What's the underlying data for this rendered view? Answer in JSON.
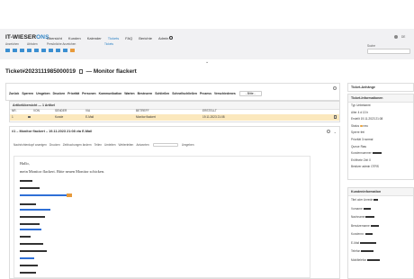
{
  "header": {
    "logo_part1": "IT-WIESER",
    "logo_part2": "ONS",
    "nav": [
      "Übersicht",
      "Kunden",
      "Kalender",
      "Tickets",
      "FAQ",
      "Berichte",
      "Admin"
    ],
    "active_nav": "Tickets",
    "user_initials": "DE",
    "sub_labels": [
      "Anzeichen",
      "Abholen",
      "Persönliche Anzeichen"
    ],
    "search_label": "Suche",
    "search_placeholder": "",
    "tickets_sub": "Tickets"
  },
  "ticket": {
    "title": "Ticket#2023111985000019",
    "subject_sep": "—",
    "subject": "Monitor flackert",
    "menu": [
      "Zurück",
      "Sperren",
      "Umgeben",
      "Drucken",
      "Priorität",
      "Personen",
      "Kommunikation",
      "Warten",
      "Besteuern",
      "Schließen",
      "Schnellschließen",
      "Prozess",
      "Verschiedenes"
    ],
    "menu_select": "- Bitte -"
  },
  "articles": {
    "title": "Artikelübersicht — 1 Artikel",
    "columns": [
      "NR.",
      "",
      "VON",
      "SENDER",
      "VIA",
      "BETREFF",
      "ERSTELLT"
    ],
    "rows": [
      {
        "nr": "1",
        "flag": "",
        "von": "",
        "sender": "Kunde",
        "via": "E-Mail",
        "betreff": "Monitor flackert",
        "erstellt": "19.11.2023 21:08"
      }
    ]
  },
  "article": {
    "title": "#1 – Monitor flackert – 19.11.2023 21:08 via E-Mail",
    "toolbar": [
      "Nachrichtenkopf anzeigen",
      "Drucken",
      "Zeitbuchungen ändern",
      "Teilen",
      "Umleiten",
      "Weiterleiten",
      "Antworten"
    ],
    "toolbar_select": "",
    "toolbar_last": "Umgeben",
    "greeting": "Hallo,",
    "body_line": "mein Monitor flackert. Bitte neuen Monitor schicken."
  },
  "sidebar": {
    "settings_title": "Ticket-Anhänge",
    "info_title": "Ticket-Informationen",
    "info": [
      {
        "label": "Typ",
        "value": "Unbekannt"
      },
      {
        "label": "Alter",
        "value": "4 d 13 h"
      },
      {
        "label": "Erstellt",
        "value": "19.11.2023 21:08"
      },
      {
        "label": "Status",
        "value": "neu"
      },
      {
        "label": "Sperre",
        "value": "frei"
      },
      {
        "label": "Priorität",
        "value": "3 normal"
      },
      {
        "label": "Queue",
        "value": "Raw"
      },
      {
        "label": "Kundennummer",
        "value": ""
      },
      {
        "label": "Eröffnete Zeit",
        "value": "0"
      },
      {
        "label": "Besitzer",
        "value": "admin OTRS"
      }
    ],
    "customer_title": "Kundeninformation",
    "customer": [
      {
        "label": "Titel oder Anrede",
        "value": ""
      },
      {
        "label": "Vorname",
        "value": ""
      },
      {
        "label": "Nachname",
        "value": ""
      },
      {
        "label": "Benutzername",
        "value": ""
      },
      {
        "label": "Kundennr.",
        "value": ""
      },
      {
        "label": "E-Mail",
        "value": ""
      },
      {
        "label": "Telefon",
        "value": ""
      },
      {
        "label": "Mobiltelefon",
        "value": ""
      }
    ],
    "status_color": "#e8a23a",
    "priority_color": "#f0ad4e"
  }
}
